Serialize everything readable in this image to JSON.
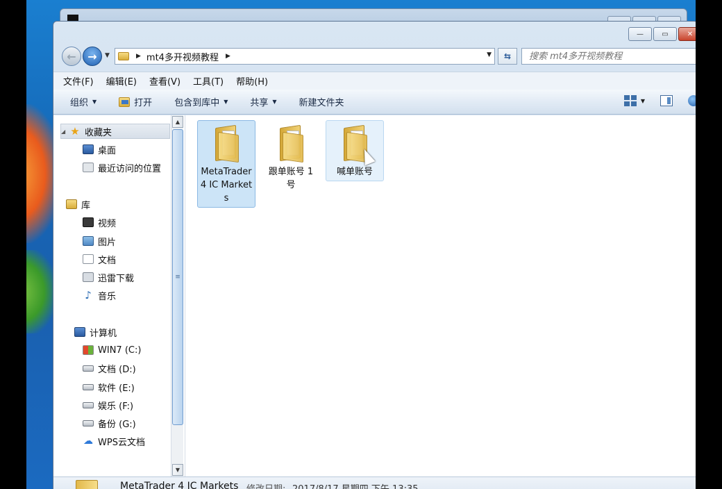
{
  "address": {
    "path": "mt4多开视频教程"
  },
  "search": {
    "placeholder": "搜索 mt4多开视频教程"
  },
  "menu": [
    "文件(F)",
    "编辑(E)",
    "查看(V)",
    "工具(T)",
    "帮助(H)"
  ],
  "toolbar": {
    "organize": "组织",
    "open": "打开",
    "include_library": "包含到库中",
    "share": "共享",
    "new_folder": "新建文件夹"
  },
  "nav": {
    "favorites": "收藏夹",
    "desktop": "桌面",
    "recent": "最近访问的位置",
    "libraries": "库",
    "videos": "视频",
    "pictures": "图片",
    "documents": "文档",
    "xunlei": "迅雷下载",
    "music": "音乐",
    "computer": "计算机",
    "drives": [
      "WIN7 (C:)",
      "文档 (D:)",
      "软件 (E:)",
      "娱乐 (F:)",
      "备份 (G:)"
    ],
    "wps": "WPS云文档"
  },
  "files": [
    {
      "name": "MetaTrader 4 IC Markets",
      "state": "selected"
    },
    {
      "name": "跟单账号 1 号",
      "state": "normal"
    },
    {
      "name": "喊单账号",
      "state": "hover"
    }
  ],
  "details": {
    "name": "MetaTrader 4 IC Markets",
    "modified_label": "修改日期:",
    "modified_value": "2017/8/17 星期四 下午 13:35"
  },
  "colors": {
    "selection": "#cce4f7",
    "toolbar": "#dde7f2",
    "desktop": "#1a6cc0"
  }
}
